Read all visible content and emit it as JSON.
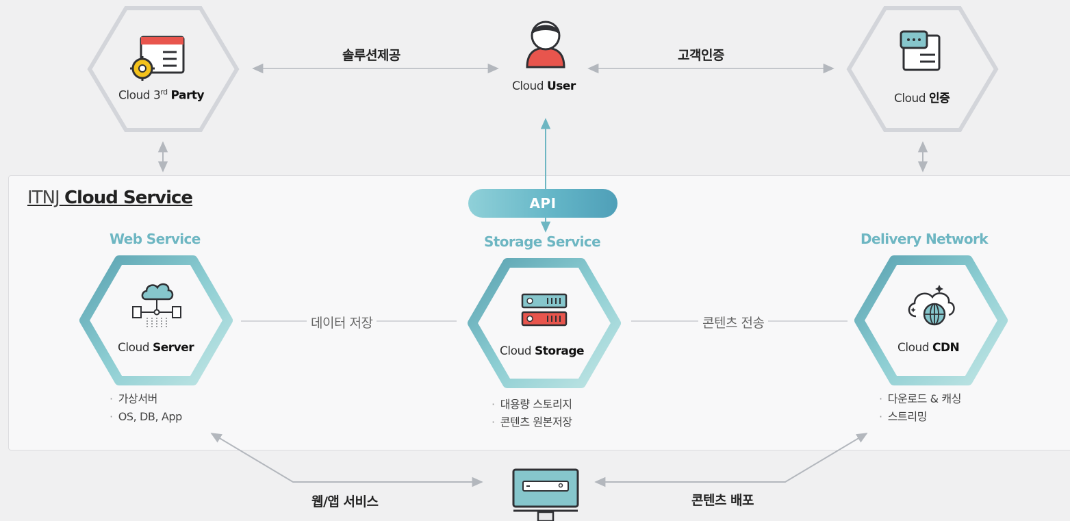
{
  "top_nodes": {
    "third_party": {
      "pre": "Cloud 3",
      "sup": "rd",
      "bold": "Party"
    },
    "user": {
      "pre": "Cloud ",
      "bold": "User"
    },
    "auth": {
      "pre": "Cloud ",
      "bold": "인증"
    }
  },
  "top_edges": {
    "solution": "솔루션제공",
    "customer_auth": "고객인증"
  },
  "panel": {
    "title_prefix": "ITNJ",
    "title_main": "Cloud Service",
    "api": "API"
  },
  "services": [
    {
      "title": "Web Service",
      "node_pre": "Cloud ",
      "node_bold": "Server",
      "bullets": [
        "가상서버",
        "OS, DB, App"
      ]
    },
    {
      "title": "Storage Service",
      "node_pre": "Cloud ",
      "node_bold": "Storage",
      "bullets": [
        "대용량 스토리지",
        "콘텐츠 원본저장"
      ]
    },
    {
      "title": "Delivery Network",
      "node_pre": "Cloud ",
      "node_bold": "CDN",
      "bullets": [
        "다운로드 & 캐싱",
        "스트리밍"
      ]
    }
  ],
  "inner_edges": {
    "data_store": "데이터 저장",
    "content_transfer": "콘텐츠 전송"
  },
  "bottom_edges": {
    "web_app": "웹/앱 서비스",
    "content_dist": "콘텐츠 배포"
  },
  "icons": [
    "gear-window-icon",
    "user-icon",
    "chat-document-icon",
    "cloud-server-icon",
    "storage-server-icon",
    "cloud-globe-icon",
    "monitor-icon"
  ],
  "colors": {
    "accent_teal": "#6db6c2",
    "hex_gray": "#d3d5da",
    "hex_teal": "#86c6cc",
    "red": "#e8554d"
  }
}
